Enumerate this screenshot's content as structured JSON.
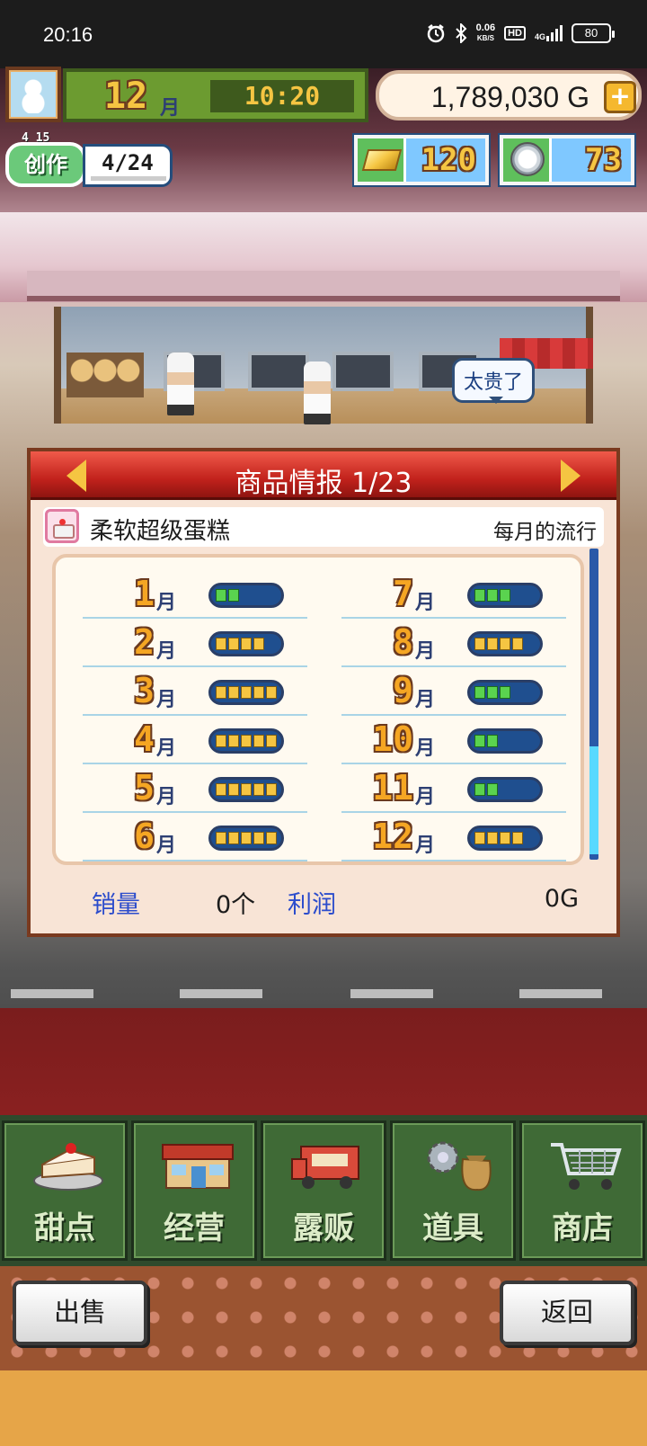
{
  "status_bar": {
    "time": "20:16",
    "net_speed": "0.06",
    "net_unit": "KB/S",
    "hd": "HD",
    "network": "4G",
    "battery": "80",
    "icons": [
      "alarm-icon",
      "bluetooth-icon",
      "signal-icon",
      "battery-icon"
    ]
  },
  "hud": {
    "month": "12",
    "month_unit": "月",
    "clock": "10:20",
    "money": "1,789,030",
    "money_unit": "G",
    "plus_label": "+",
    "create_label": "创作",
    "create_small": "4 15",
    "create_progress": "4/24",
    "gold_count": "120",
    "silver_count": "73"
  },
  "scene": {
    "speech_bubble": "太贵了"
  },
  "dialog": {
    "title": "商品情报 1/23",
    "product_name": "柔软超级蛋糕",
    "trend_label": "每月的流行",
    "months": [
      {
        "num": "1",
        "unit": "月",
        "level": 2,
        "color": "green"
      },
      {
        "num": "2",
        "unit": "月",
        "level": 4,
        "color": "yellow"
      },
      {
        "num": "3",
        "unit": "月",
        "level": 5,
        "color": "yellow"
      },
      {
        "num": "4",
        "unit": "月",
        "level": 5,
        "color": "yellow"
      },
      {
        "num": "5",
        "unit": "月",
        "level": 5,
        "color": "yellow"
      },
      {
        "num": "6",
        "unit": "月",
        "level": 5,
        "color": "yellow"
      },
      {
        "num": "7",
        "unit": "月",
        "level": 3,
        "color": "green"
      },
      {
        "num": "8",
        "unit": "月",
        "level": 4,
        "color": "yellow"
      },
      {
        "num": "9",
        "unit": "月",
        "level": 3,
        "color": "green"
      },
      {
        "num": "10",
        "unit": "月",
        "level": 2,
        "color": "green"
      },
      {
        "num": "11",
        "unit": "月",
        "level": 2,
        "color": "green"
      },
      {
        "num": "12",
        "unit": "月",
        "level": 4,
        "color": "yellow"
      }
    ],
    "max_level": 5,
    "sales_label": "销量",
    "sales_value": "0个",
    "profit_label": "利润",
    "profit_value": "0G"
  },
  "menu": {
    "items": [
      {
        "label": "甜点",
        "icon": "cake-icon"
      },
      {
        "label": "经营",
        "icon": "shop-icon"
      },
      {
        "label": "露贩",
        "icon": "food-truck-icon"
      },
      {
        "label": "道具",
        "icon": "items-bag-icon"
      },
      {
        "label": "商店",
        "icon": "cart-icon"
      }
    ]
  },
  "buttons": {
    "sell": "出售",
    "back": "返回"
  },
  "colors": {
    "meter_yellow": "#f5c542",
    "meter_green": "#5ad34f",
    "header_red": "#c2221c",
    "label_blue": "#2c4ccc"
  }
}
